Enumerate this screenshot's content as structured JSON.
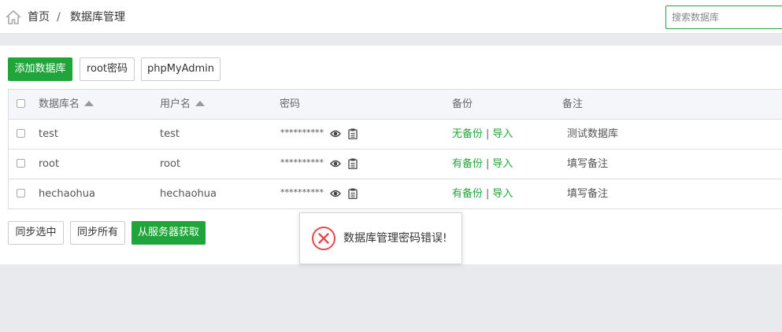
{
  "breadcrumb": {
    "home": "首页",
    "separator": "/",
    "current": "数据库管理"
  },
  "search": {
    "placeholder": "搜索数据库"
  },
  "toolbar": {
    "add_label": "添加数据库",
    "root_pw_label": "root密码",
    "phpmyadmin_label": "phpMyAdmin"
  },
  "table": {
    "headers": {
      "name": "数据库名",
      "user": "用户名",
      "password": "密码",
      "backup": "备份",
      "remark": "备注"
    },
    "rows": [
      {
        "name": "test",
        "user": "test",
        "password": "**********",
        "backup": "无备份",
        "import": "导入",
        "remark": "测试数据库"
      },
      {
        "name": "root",
        "user": "root",
        "password": "**********",
        "backup": "有备份",
        "import": "导入",
        "remark": "填写备注"
      },
      {
        "name": "hechaohua",
        "user": "hechaohua",
        "password": "**********",
        "backup": "有备份",
        "import": "导入",
        "remark": "填写备注"
      }
    ]
  },
  "bottom": {
    "sync_selected": "同步选中",
    "sync_all": "同步所有",
    "fetch_from_server": "从服务器获取"
  },
  "toast": {
    "message": "数据库管理密码错误!",
    "icon": "error-circle-icon"
  },
  "colors": {
    "accent": "#20a53a",
    "error": "#e8484b"
  }
}
